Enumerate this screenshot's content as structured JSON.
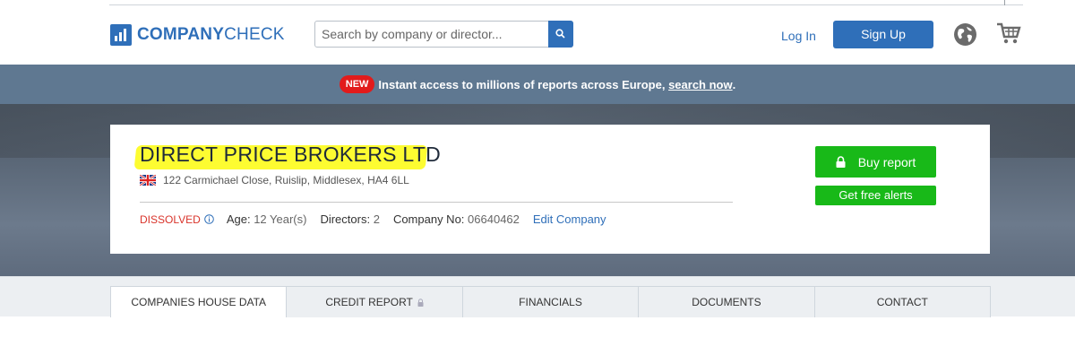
{
  "brand": {
    "bold": "COMPANY",
    "light": "CHECK"
  },
  "search": {
    "placeholder": "Search by company or director..."
  },
  "nav": {
    "login": "Log In",
    "signup": "Sign Up"
  },
  "icons": [
    "logo-bars-icon",
    "search-icon",
    "globe-icon",
    "cart-icon",
    "uk-flag-icon",
    "info-icon",
    "lock-icon"
  ],
  "promo": {
    "badge": "NEW",
    "text": "Instant access to millions of reports across Europe, ",
    "link": "search now",
    "end": "."
  },
  "company": {
    "name": "DIRECT PRICE BROKERS LTD",
    "address": "122 Carmichael Close, Ruislip, Middlesex, HA4 6LL",
    "status": "DISSOLVED",
    "age_label": "Age:",
    "age_value": "12 Year(s)",
    "directors_label": "Directors:",
    "directors_value": "2",
    "company_no_label": "Company No:",
    "company_no_value": "06640462",
    "edit_label": "Edit Company"
  },
  "actions": {
    "buy_report": "Buy report",
    "free_alerts": "Get free alerts"
  },
  "tabs": [
    {
      "label": "COMPANIES HOUSE DATA",
      "active": true
    },
    {
      "label": "CREDIT REPORT",
      "locked": true
    },
    {
      "label": "FINANCIALS"
    },
    {
      "label": "DOCUMENTS"
    },
    {
      "label": "CONTACT"
    }
  ],
  "colors": {
    "brand_blue": "#2f6fb9",
    "green": "#18b918",
    "dissolved_red": "#d9342b",
    "highlight": "#fdfc31",
    "promo_bg": "#5f7891",
    "badge_red": "#e21b1b"
  }
}
